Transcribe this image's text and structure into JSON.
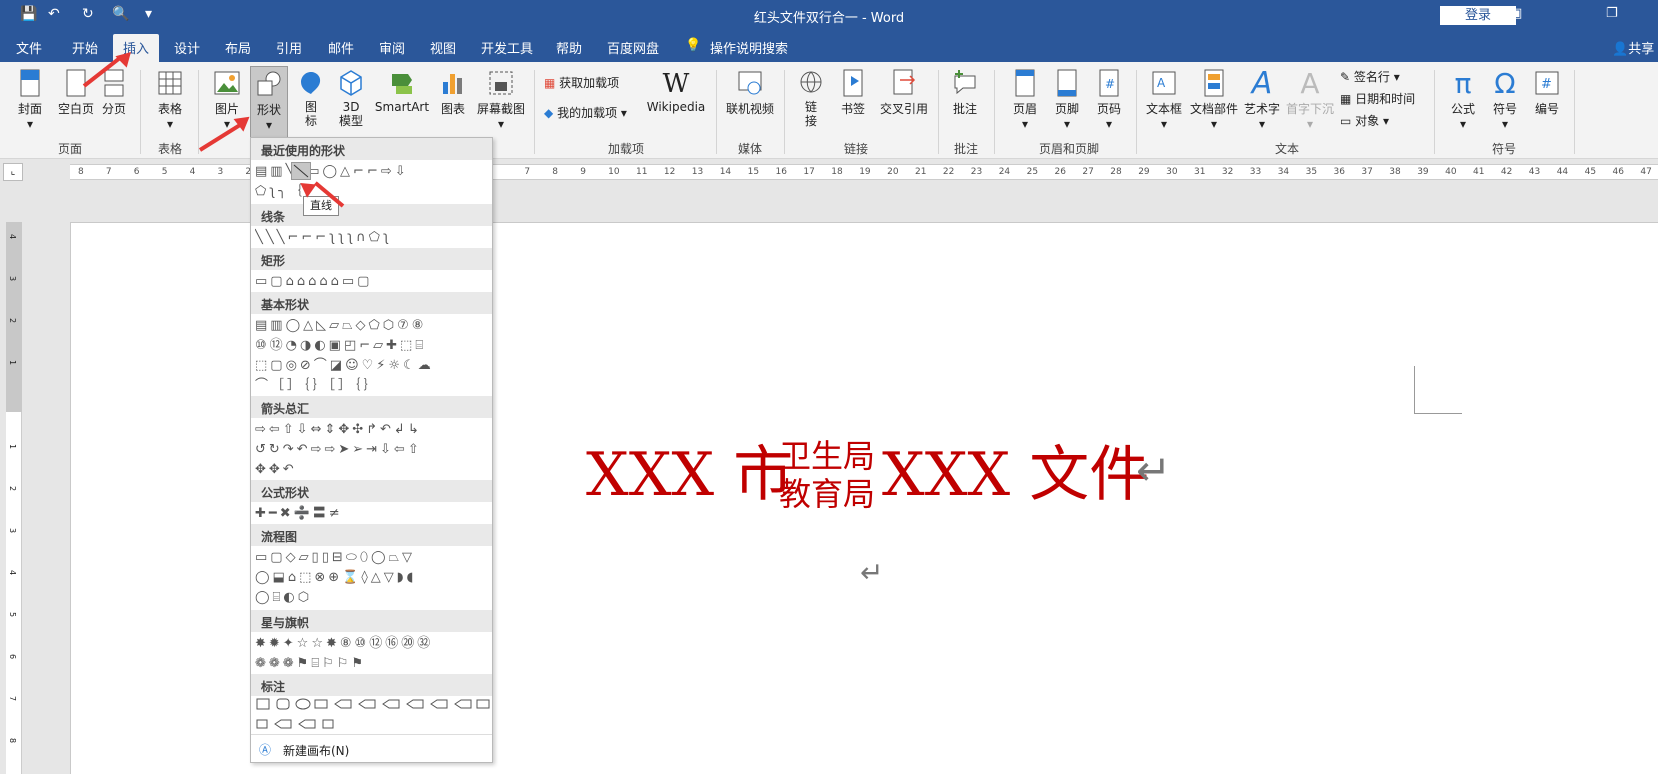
{
  "window": {
    "title": "红头文件双行合一  -  Word",
    "login": "登录",
    "share": "共享"
  },
  "tabs": [
    "文件",
    "开始",
    "插入",
    "设计",
    "布局",
    "引用",
    "邮件",
    "审阅",
    "视图",
    "开发工具",
    "帮助",
    "百度网盘",
    "操作说明搜索"
  ],
  "ribbon": {
    "pages": {
      "cover": "封面",
      "blank": "空白页",
      "break": "分页",
      "group": "页面"
    },
    "tables": {
      "table": "表格",
      "group": "表格"
    },
    "illustrations": {
      "picture": "图片",
      "shapes": "形状",
      "icons": "图\n标",
      "model3d": "3D\n模型",
      "smartart": "SmartArt",
      "chart": "图表",
      "screenshot": "屏幕截图"
    },
    "addins": {
      "get": "获取加载项",
      "mine": "我的加载项",
      "wiki": "Wikipedia",
      "group": "加载项"
    },
    "media": {
      "video": "联机视频",
      "group": "媒体"
    },
    "links": {
      "link": "链\n接",
      "bookmark": "书签",
      "crossref": "交叉引用",
      "group": "链接"
    },
    "comments": {
      "comment": "批注",
      "group": "批注"
    },
    "headerfooter": {
      "header": "页眉",
      "footer": "页脚",
      "pagenum": "页码",
      "group": "页眉和页脚"
    },
    "text": {
      "textbox": "文本框",
      "parts": "文档部件",
      "wordart": "艺术字",
      "dropcap": "首字下沉",
      "signature": "签名行",
      "datetime": "日期和时间",
      "object": "对象",
      "group": "文本"
    },
    "symbols": {
      "equation": "公式",
      "symbol": "符号",
      "number": "编号",
      "group": "符号"
    }
  },
  "ruler": {
    "ticks": [
      "8",
      "7",
      "6",
      "5",
      "4",
      "3",
      "2",
      "1",
      "",
      "",
      "",
      "",
      "",
      "",
      "",
      "",
      "7",
      "8",
      "9",
      "10",
      "11",
      "12",
      "13",
      "14",
      "15",
      "16",
      "17",
      "18",
      "19",
      "20",
      "21",
      "22",
      "23",
      "24",
      "25",
      "26",
      "27",
      "28",
      "29",
      "30",
      "31",
      "32",
      "33",
      "34",
      "35",
      "36",
      "37",
      "38",
      "39",
      "40",
      "41",
      "42",
      "43",
      "44",
      "45",
      "46",
      "47",
      "48"
    ]
  },
  "vruler": {
    "ticks": [
      "4",
      "3",
      "2",
      "1",
      "",
      "1",
      "2",
      "3",
      "4",
      "5",
      "6",
      "7",
      "8"
    ]
  },
  "document": {
    "left": "XXX 市",
    "top": "卫生局",
    "bottom": "教育局",
    "right": "XXX 文件",
    "return": "↵"
  },
  "dropdown": {
    "sections": [
      "最近使用的形状",
      "线条",
      "矩形",
      "基本形状",
      "箭头总汇",
      "公式形状",
      "流程图",
      "星与旗帜",
      "标注"
    ],
    "tooltip": "直线",
    "new_canvas": "新建画布(N)",
    "rows": {
      "recent1": "▤▥╲╲▭◯△⌐⌐⇨⇩",
      "recent2": "⬠ʅ╮｛｝",
      "lines": "╲╲╲⌐⌐⌐ʅʅʅ∩⬠ʅ",
      "rects": "▭▢⌂⌂⌂⌂⌂▭▢",
      "basic1": "▤▥◯△◺▱⏢◇⬠⬡⑦⑧",
      "basic2": "⑩⑫◔◑◐▣◰⌐▱✚⬚⌸",
      "basic3": "⬚▢◎⊘⌒◪☺♡⚡☼☾☁",
      "basic4": "⌒［］｛｝［］｛｝",
      "arrows1": "⇨⇦⇧⇩⇔⇕✥✣↱↶↲↳",
      "arrows2": "↺↻↷↶⇨⇨➤➢⇥⇩⇦⇧",
      "arrows3": "✥✥↶",
      "math": "✚━✖➗〓≠",
      "flow1": "▭▢◇▱▯▯⊟⬭⬯◯⏢▽",
      "flow2": "◯⬓⌂⬚⊗⊕⌛◊△▽◗◖",
      "flow3": "◯⌸◐⬡",
      "stars1": "✸✹✦☆☆✸⑧⑩⑫⑯⑳㉜",
      "stars2": "❁❁❁⚑⌸⚐⚐⚑"
    }
  },
  "colors": {
    "brand": "#2b579a",
    "red": "#c00000",
    "annotation": "#e53935"
  }
}
